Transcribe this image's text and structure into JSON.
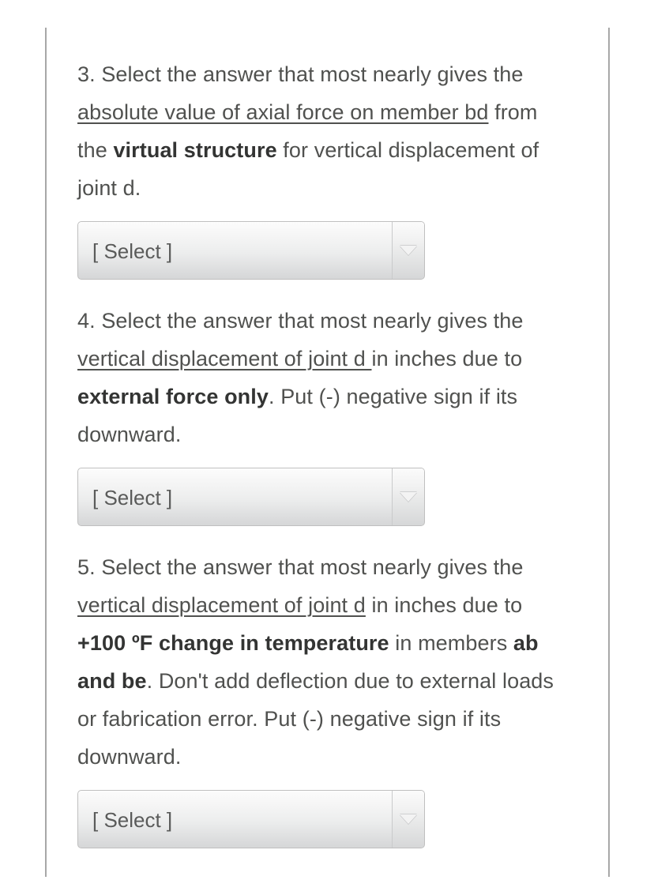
{
  "page": {
    "background_color": "#ffffff",
    "rule_color": "#a8a8a8",
    "text_color": "#50514f",
    "bold_text_color": "#333433"
  },
  "questions": [
    {
      "id": "q3",
      "number": "3.",
      "segments": [
        {
          "text": "3. Select the answer that most nearly gives the ",
          "style": "normal"
        },
        {
          "text": "absolute value of axial force on member bd",
          "style": "underline"
        },
        {
          "text": " from the ",
          "style": "normal"
        },
        {
          "text": "virtual structure",
          "style": "bold"
        },
        {
          "text": " for vertical displacement of joint d.",
          "style": "normal"
        }
      ],
      "full_text": "3. Select the answer that most nearly gives the absolute value of axial force on member bd from the virtual structure for vertical displacement of joint d.",
      "dropdown": {
        "name": "select-q3",
        "selected_value": "[ Select ]",
        "arrow_icon": "chevron-down-icon"
      }
    },
    {
      "id": "q4",
      "number": "4.",
      "segments": [
        {
          "text": "4. Select the answer that most nearly gives the ",
          "style": "normal"
        },
        {
          "text": "vertical displacement of joint d ",
          "style": "underline"
        },
        {
          "text": "in inches due to ",
          "style": "normal"
        },
        {
          "text": "external force only",
          "style": "bold"
        },
        {
          "text": ". Put (-) negative sign if its downward.",
          "style": "normal"
        }
      ],
      "full_text": "4. Select the answer that most nearly gives the vertical displacement of joint d in inches due to external force only. Put (-) negative sign if its downward.",
      "dropdown": {
        "name": "select-q4",
        "selected_value": "[ Select ]",
        "arrow_icon": "chevron-down-icon"
      }
    },
    {
      "id": "q5",
      "number": "5.",
      "segments": [
        {
          "text": "5. Select the answer that most nearly gives the ",
          "style": "normal"
        },
        {
          "text": "vertical displacement of joint d",
          "style": "underline"
        },
        {
          "text": " in inches due to ",
          "style": "normal"
        },
        {
          "text": "+100 ºF change in temperature",
          "style": "bold"
        },
        {
          "text": " in members ",
          "style": "normal"
        },
        {
          "text": "ab and be",
          "style": "bold"
        },
        {
          "text": ". Don't add deflection due to external loads or fabrication error. Put (-) negative sign if its downward.",
          "style": "normal"
        }
      ],
      "full_text": "5. Select the answer that most nearly gives the vertical displacement of joint d in inches due to +100 ºF change in temperature in members ab and be. Don't add deflection due to external loads or fabrication error. Put (-) negative sign if its downward.",
      "dropdown": {
        "name": "select-q5",
        "selected_value": "[ Select ]",
        "arrow_icon": "chevron-down-icon"
      }
    }
  ]
}
